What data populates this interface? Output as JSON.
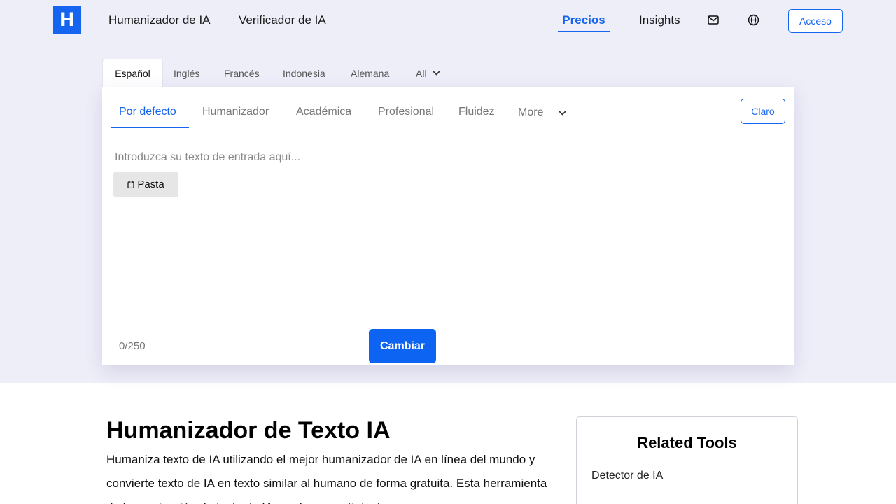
{
  "header": {
    "logo_letter": "H",
    "nav": {
      "humanizer": "Humanizador de IA",
      "verifier": "Verificador de IA",
      "pricing": "Precios",
      "insights": "Insights"
    },
    "icons": [
      "mail-icon",
      "globe-icon"
    ],
    "login": "Acceso"
  },
  "languages": {
    "tabs": [
      "Español",
      "Inglés",
      "Francés",
      "Indonesia",
      "Alemana"
    ],
    "all": "All",
    "active": "Español"
  },
  "editor": {
    "modes": [
      "Por defecto",
      "Humanizador",
      "Académica",
      "Profesional",
      "Fluidez"
    ],
    "more": "More",
    "active_mode": "Por defecto",
    "theme_button": "Claro",
    "input_placeholder": "Introduzca su texto de entrada aquí...",
    "paste_label": "Pasta",
    "counter": "0/250",
    "submit_label": "Cambiar"
  },
  "content": {
    "title": "Humanizador de Texto IA",
    "description": "Humaniza texto de IA utilizando el mejor humanizador de IA en línea del mundo y convierte texto de IA en texto similar al humano de forma gratuita. Esta herramienta de humanización de texto de IA puede convertir texto"
  },
  "related_tools": {
    "title": "Related Tools",
    "items": [
      "Detector de IA"
    ]
  },
  "colors": {
    "accent": "#1565f0",
    "hero_background": "#eeeef9",
    "button_primary": "#0d63f2"
  }
}
